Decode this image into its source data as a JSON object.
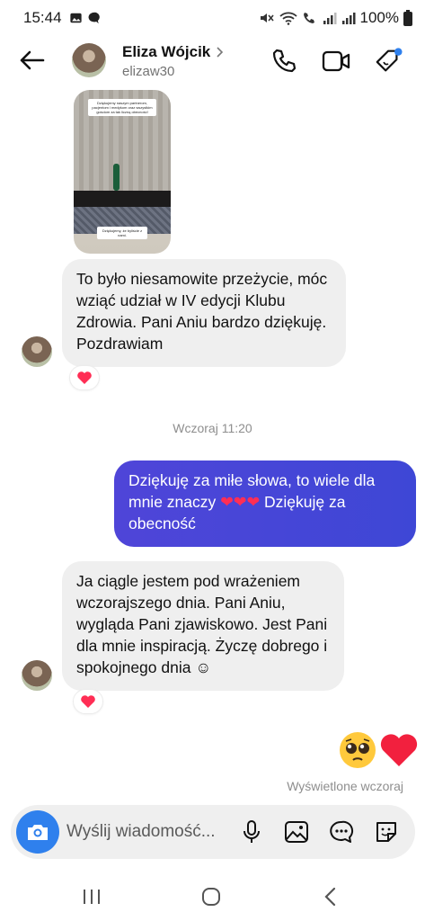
{
  "status_bar": {
    "time": "15:44",
    "battery": "100%"
  },
  "header": {
    "name": "Eliza Wójcik",
    "handle": "elizaw30"
  },
  "thread": {
    "photo": {
      "top_caption": "Dziękujemy naszym partnerom, pacjentom i medykom oraz wszystkim gościom za tak liczną obecność!",
      "bottom_caption": "Dziękujemy, że byliście z nami."
    },
    "msg1": "To było niesamowite przeżycie, móc wziąć udział w IV edycji Klubu Zdrowia. Pani Aniu bardzo dziękuję. Pozdrawiam",
    "timestamp": "Wczoraj 11:20",
    "msg2_a": "Dziękuję za miłe słowa, to wiele dla mnie znaczy ",
    "msg2_hearts": "❤❤❤",
    "msg2_b": " Dziękuję za obecność",
    "msg3": "Ja ciągle jestem pod wrażeniem wczorajszego dnia. Pani Aniu, wygląda Pani zjawiskowo. Jest Pani dla mnie inspiracją. Życzę dobrego i spokojnego dnia ☺",
    "seen": "Wyświetlone wczoraj"
  },
  "composer": {
    "placeholder": "Wyślij wiadomość..."
  },
  "colors": {
    "accent": "#2f80ed",
    "outgoing": "#4a46d8",
    "incoming": "#efefef",
    "heart": "#ff2e55"
  },
  "icons": [
    "back-arrow-icon",
    "chevron-right-icon",
    "phone-icon",
    "video-icon",
    "tag-icon",
    "camera-icon",
    "microphone-icon",
    "gallery-icon",
    "chat-bubble-icon",
    "sticker-icon",
    "recents-icon",
    "home-icon",
    "back-icon"
  ]
}
